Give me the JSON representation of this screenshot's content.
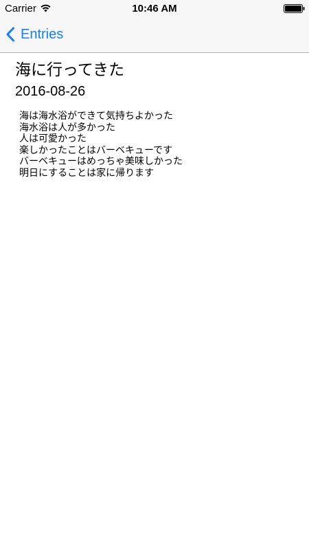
{
  "status_bar": {
    "carrier": "Carrier",
    "time": "10:46 AM",
    "icons": [
      "wifi-icon",
      "battery-icon"
    ]
  },
  "nav_bar": {
    "back_label": "Entries",
    "back_icon": "chevron-left-icon",
    "accent_color": "#157efb"
  },
  "entry": {
    "title": "海に行ってきた",
    "date": "2016-08-26",
    "body_lines": [
      "海は海水浴ができて気持ちよかった",
      "海水浴は人が多かった",
      "人は可愛かった",
      "楽しかったことはバーベキューです",
      "バーベキューはめっちゃ美味しかった",
      "明日にすることは家に帰ります"
    ]
  }
}
